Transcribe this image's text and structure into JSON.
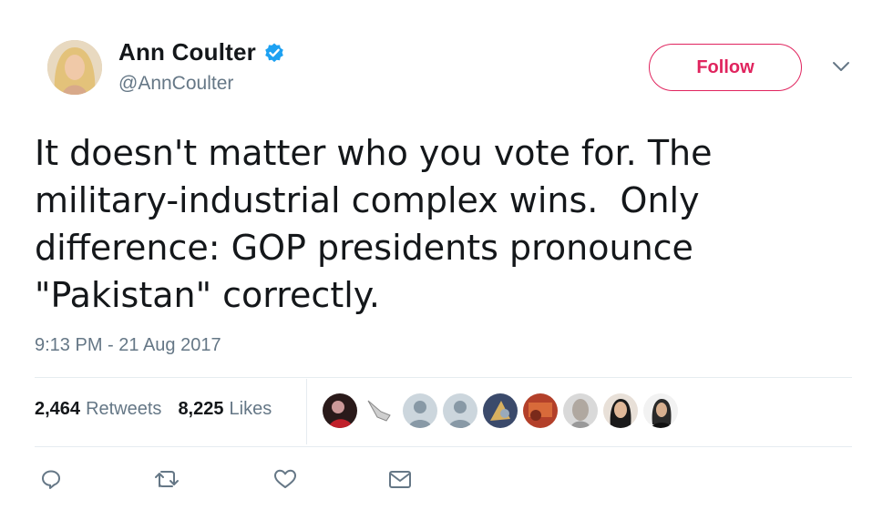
{
  "author": {
    "display_name": "Ann Coulter",
    "handle": "@AnnCoulter",
    "verified_icon": "verified-badge-icon"
  },
  "follow_button": {
    "label": "Follow"
  },
  "menu": {
    "icon": "chevron-down-icon"
  },
  "tweet": {
    "text": "It doesn't matter who you vote for. The\nmilitary-industrial complex wins.  Only\ndifference: GOP presidents pronounce\n\"Pakistan\" correctly.",
    "timestamp": "9:13 PM - 21 Aug 2017"
  },
  "stats": {
    "retweets_count": "2,464",
    "retweets_label": "Retweets",
    "likes_count": "8,225",
    "likes_label": "Likes"
  },
  "likers": {
    "count": 9
  },
  "actions": [
    "reply-icon",
    "retweet-icon",
    "like-icon",
    "direct-message-icon"
  ],
  "colors": {
    "follow_accent": "#e0245e",
    "verified_blue": "#1da1f2",
    "secondary_text": "#657786",
    "divider": "#e6ecf0"
  }
}
